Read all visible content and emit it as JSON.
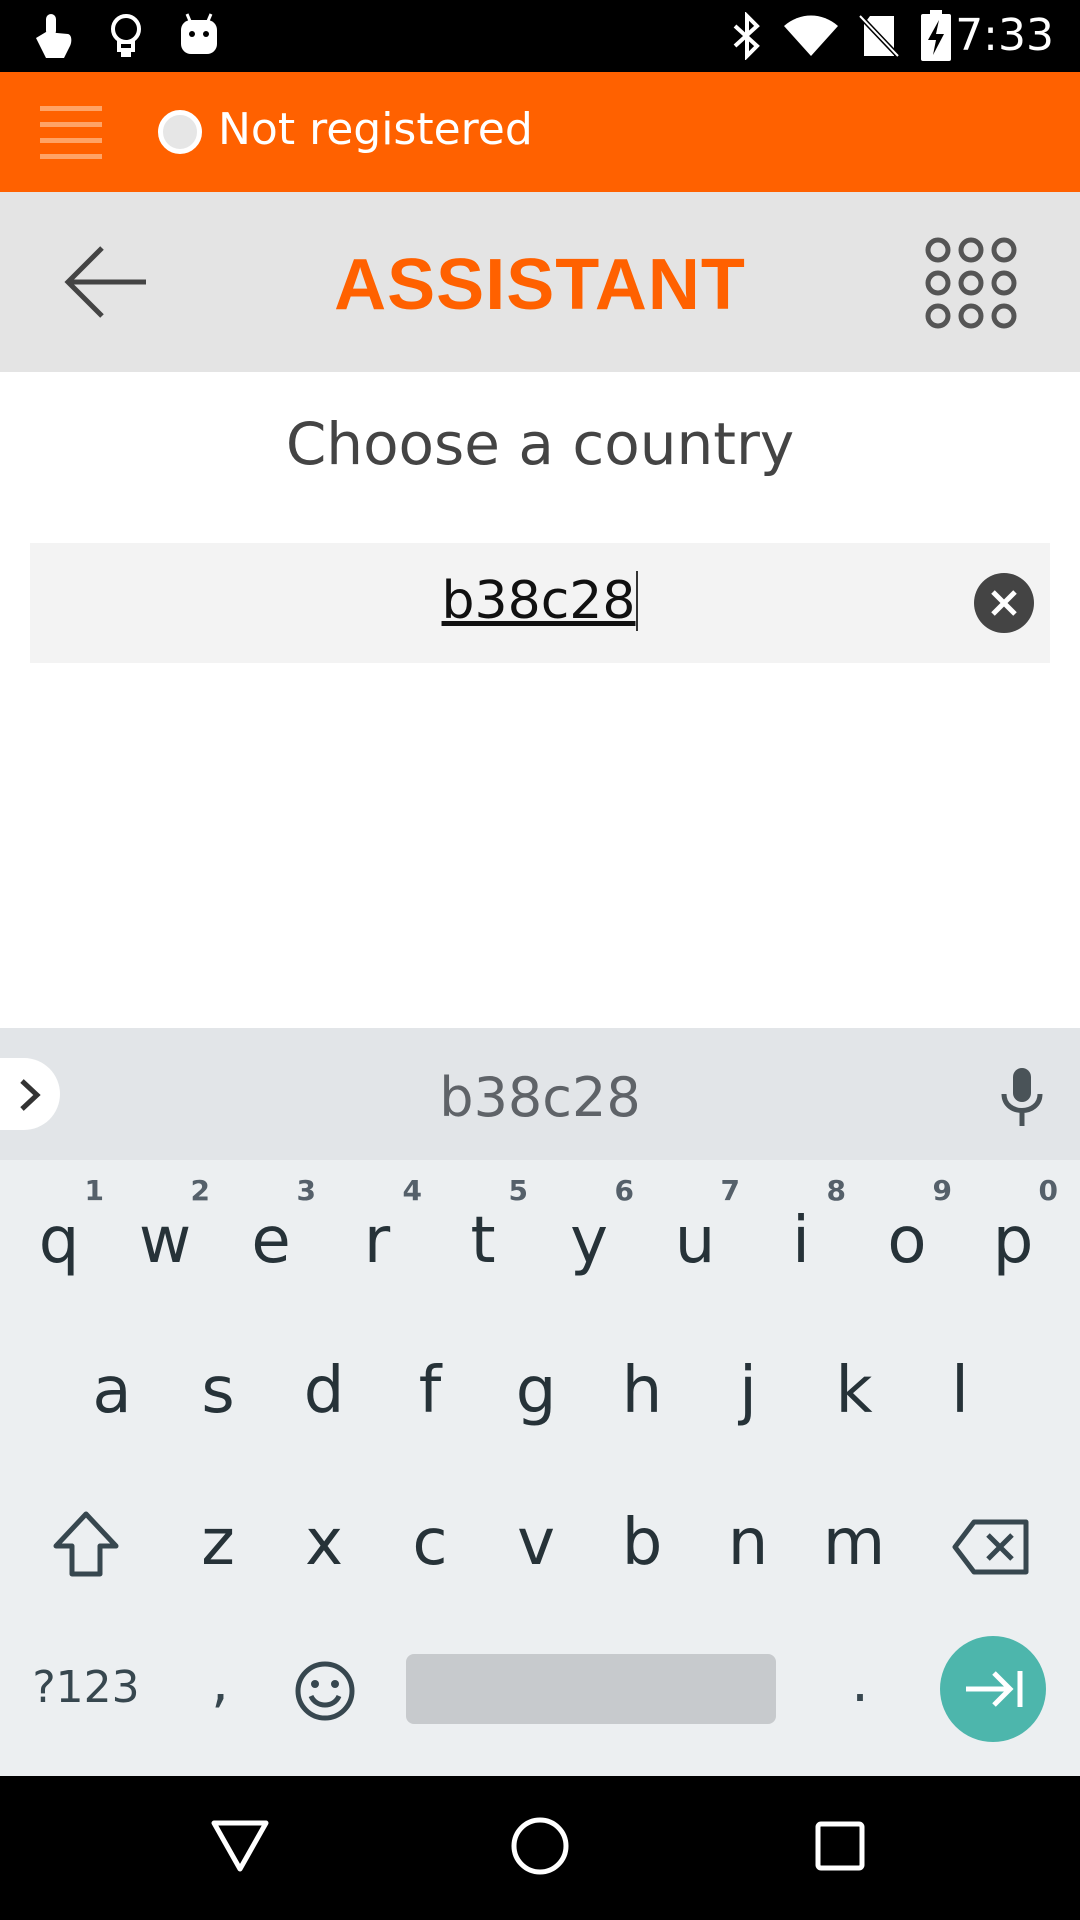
{
  "status_bar": {
    "time": "7:33",
    "left_icons": [
      "touch-icon",
      "lightbulb-icon",
      "android-icon"
    ],
    "right_icons": [
      "bluetooth-icon",
      "wifi-icon",
      "no-sim-icon",
      "battery-charging-icon"
    ]
  },
  "app_bar": {
    "menu_icon": "hamburger-menu-icon",
    "registration_status": "Not registered",
    "colors": {
      "accent": "#ff6100"
    }
  },
  "toolbar": {
    "title": "ASSISTANT",
    "back_icon": "back-arrow-icon",
    "keypad_icon": "dialpad-icon"
  },
  "main": {
    "heading": "Choose a country",
    "search": {
      "value": "b38c28",
      "clear_icon": "clear-icon"
    }
  },
  "keyboard": {
    "suggestion": "b38c28",
    "row1": [
      {
        "letter": "q",
        "hint": "1"
      },
      {
        "letter": "w",
        "hint": "2"
      },
      {
        "letter": "e",
        "hint": "3"
      },
      {
        "letter": "r",
        "hint": "4"
      },
      {
        "letter": "t",
        "hint": "5"
      },
      {
        "letter": "y",
        "hint": "6"
      },
      {
        "letter": "u",
        "hint": "7"
      },
      {
        "letter": "i",
        "hint": "8"
      },
      {
        "letter": "o",
        "hint": "9"
      },
      {
        "letter": "p",
        "hint": "0"
      }
    ],
    "row2": [
      "a",
      "s",
      "d",
      "f",
      "g",
      "h",
      "j",
      "k",
      "l"
    ],
    "row3": [
      "z",
      "x",
      "c",
      "v",
      "b",
      "n",
      "m"
    ],
    "symbols_label": "?123",
    "comma_label": ",",
    "period_label": ".",
    "enter_color": "#4db6ac"
  },
  "nav_bar": {
    "icons": [
      "back-triangle-icon",
      "home-circle-icon",
      "recents-square-icon"
    ]
  }
}
